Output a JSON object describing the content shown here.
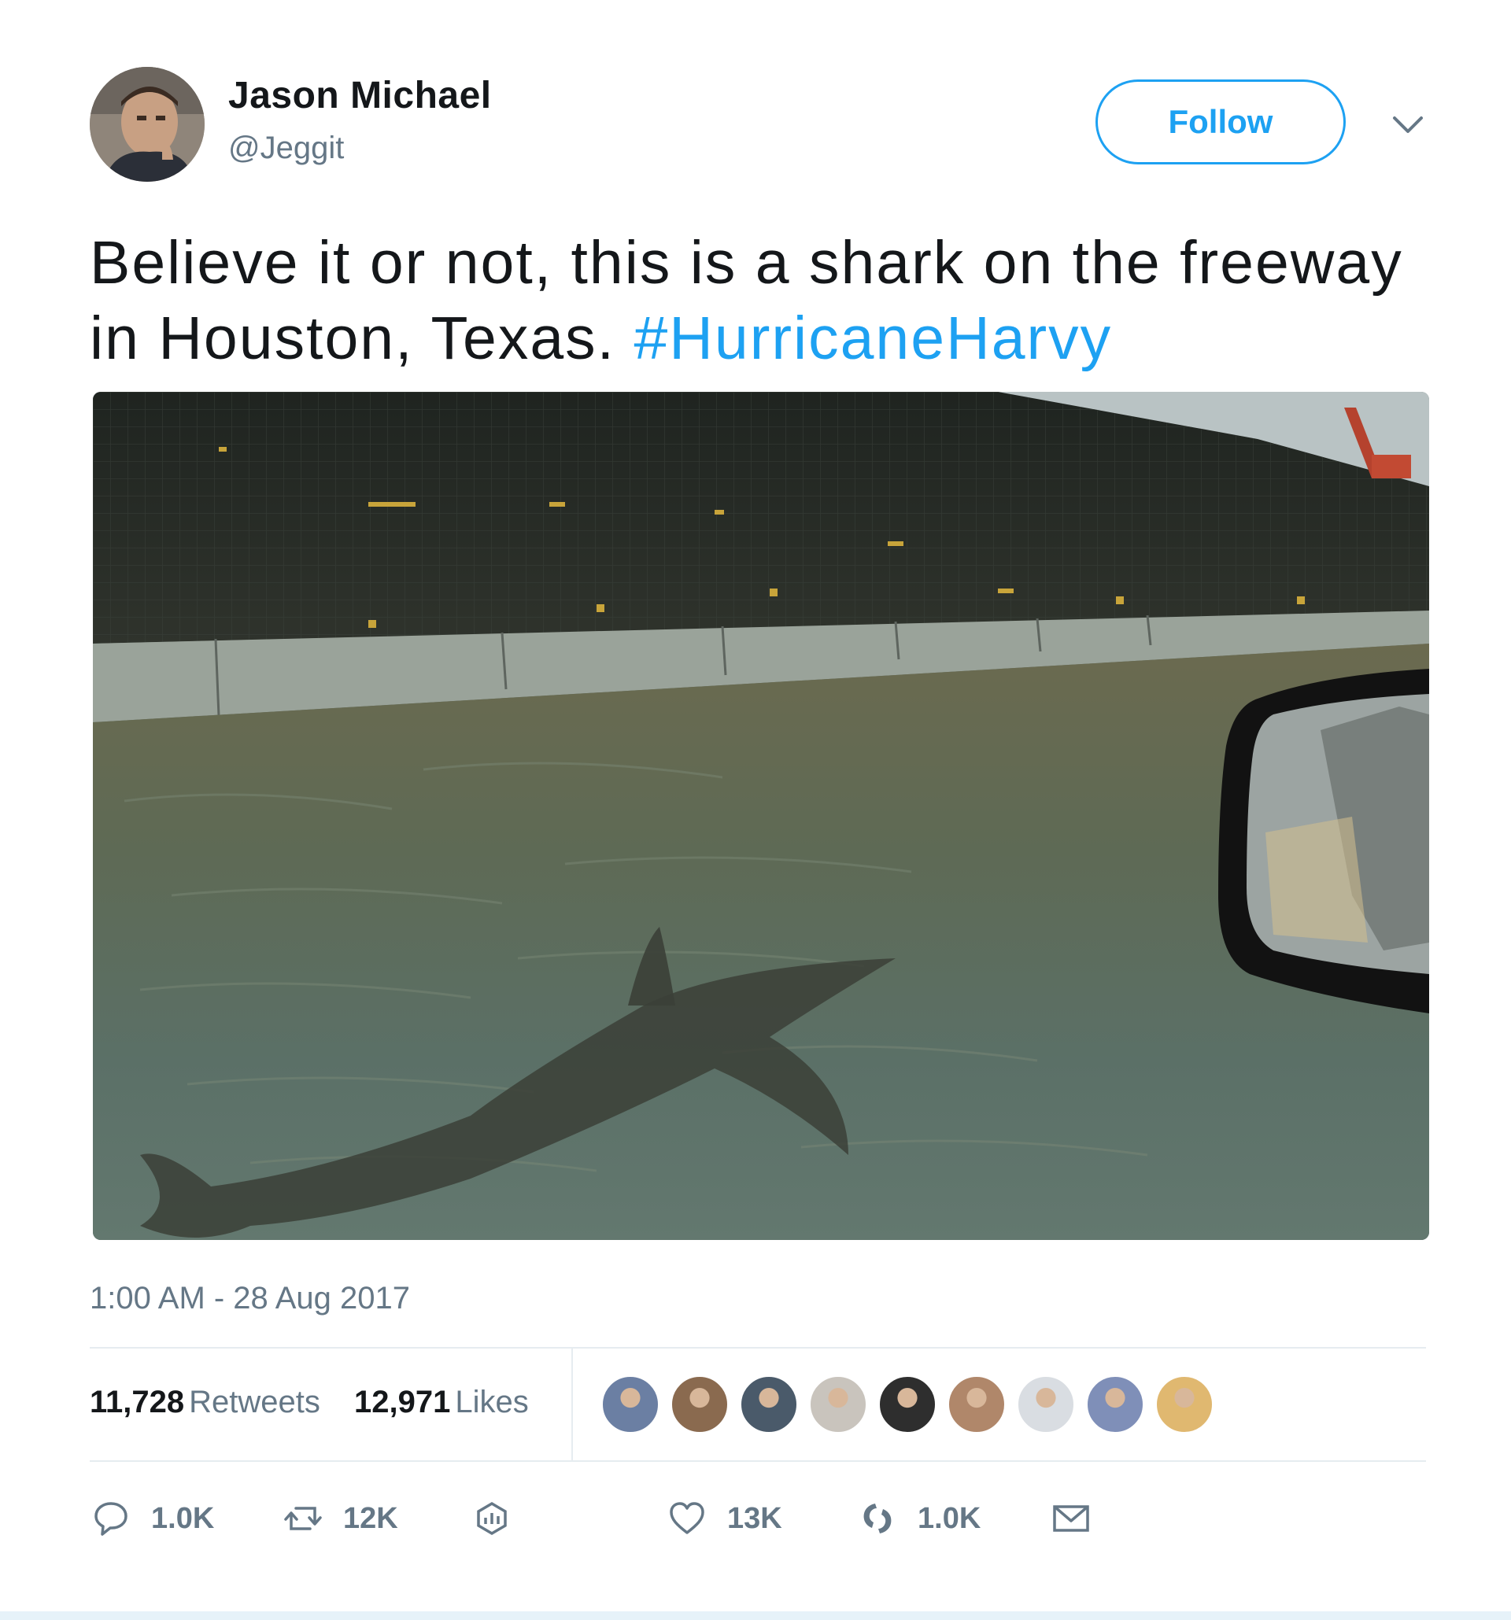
{
  "author": {
    "display_name": "Jason Michael",
    "handle": "@Jeggit"
  },
  "header": {
    "follow_label": "Follow"
  },
  "tweet": {
    "text": "Believe it or not, this is a shark on the freeway in Houston, Texas.",
    "hashtag": "#HurricaneHarvy",
    "timestamp": "1:00 AM - 28 Aug 2017"
  },
  "stats": {
    "retweets_count": "11,728",
    "retweets_label": "Retweets",
    "likes_count": "12,971",
    "likes_label": "Likes"
  },
  "likers": [
    {
      "color": "#6b7fa3"
    },
    {
      "color": "#8a6a4f"
    },
    {
      "color": "#4a5a6a"
    },
    {
      "color": "#c9c4bd"
    },
    {
      "color": "#2e2e2e"
    },
    {
      "color": "#b0876a"
    },
    {
      "color": "#d9dde2"
    },
    {
      "color": "#7f8fb8"
    },
    {
      "color": "#e0b870"
    }
  ],
  "actions": {
    "reply_count": "1.0K",
    "retweet_count": "12K",
    "like_count": "13K",
    "share_count": "1.0K"
  },
  "colors": {
    "accent": "#1da1f2",
    "muted": "#657786",
    "text": "#14171a"
  }
}
